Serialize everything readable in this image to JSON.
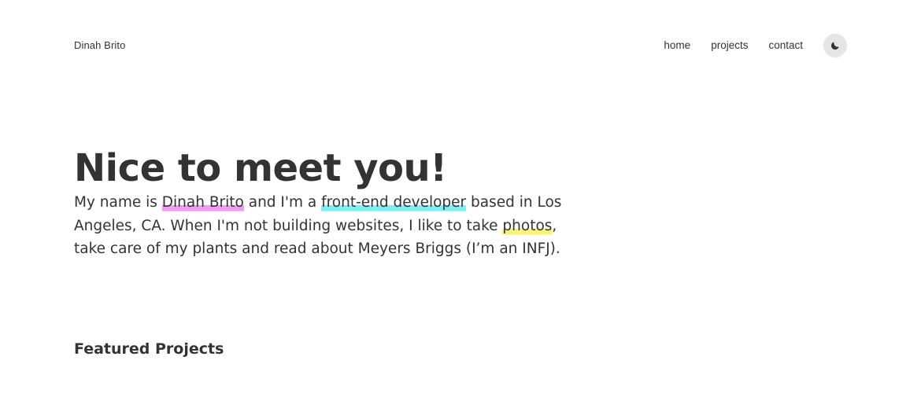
{
  "header": {
    "brand": "Dinah Brito",
    "nav": [
      {
        "label": "home"
      },
      {
        "label": "projects"
      },
      {
        "label": "contact"
      }
    ],
    "theme_toggle_icon": "moon-icon"
  },
  "hero": {
    "title": "Nice to meet you!",
    "intro": {
      "part1": "My name is ",
      "name": "Dinah Brito",
      "part2": " and I'm a ",
      "role": "front-end developer",
      "part3": " based in Los Angeles, CA. When I'm not building websites, I like to take ",
      "photos": "photos",
      "part4": ", take care of my plants and read about Meyers Briggs (I’m an INFJ)."
    }
  },
  "featured": {
    "title": "Featured Projects"
  },
  "colors": {
    "highlight_name": "#f09af0",
    "highlight_role": "#7ff0f0",
    "highlight_photos": "#fbf27a",
    "toggle_bg": "#e5e5e5",
    "text": "#333333"
  }
}
